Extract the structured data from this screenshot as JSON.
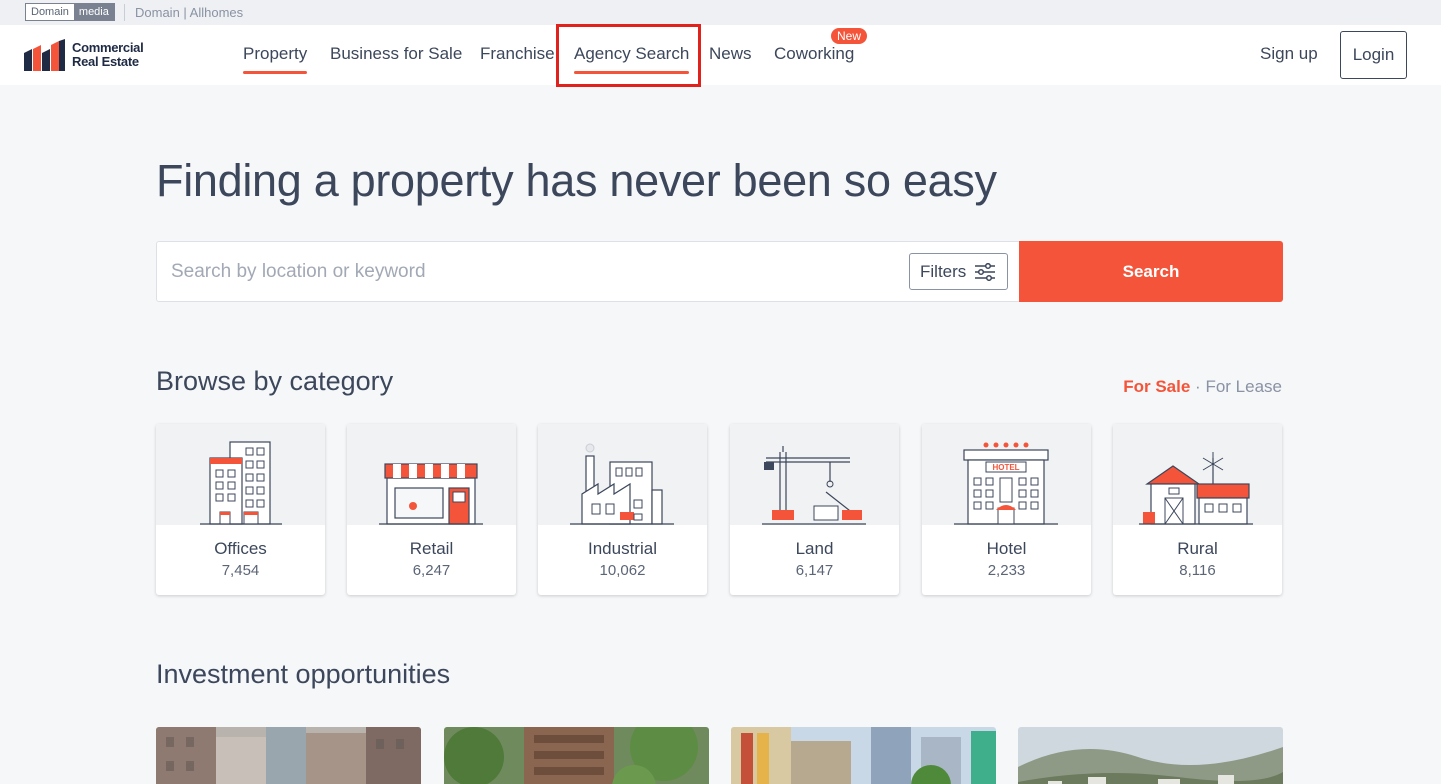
{
  "mediabar": {
    "badge_left": "Domain",
    "badge_right": "media",
    "links": "Domain | Allhomes"
  },
  "header": {
    "logo_line1": "Commercial",
    "logo_line2": "Real Estate",
    "nav": [
      {
        "label": "Property",
        "active": true
      },
      {
        "label": "Business for Sale"
      },
      {
        "label": "Franchise"
      },
      {
        "label": "Agency Search",
        "active": true
      },
      {
        "label": "News"
      },
      {
        "label": "Coworking"
      }
    ],
    "new_badge": "New",
    "signup_label": "Sign up",
    "login_label": "Login"
  },
  "hero": {
    "title": "Finding a property has never been so easy",
    "search_placeholder": "Search by location or keyword",
    "filters_label": "Filters",
    "search_label": "Search"
  },
  "browse": {
    "title": "Browse by category",
    "toggle_on": "For Sale",
    "toggle_sep": "·",
    "toggle_off": "For Lease",
    "categories": [
      {
        "name": "Offices",
        "count": "7,454",
        "icon": "office-building-icon"
      },
      {
        "name": "Retail",
        "count": "6,247",
        "icon": "shopfront-icon"
      },
      {
        "name": "Industrial",
        "count": "10,062",
        "icon": "factory-icon"
      },
      {
        "name": "Land",
        "count": "6,147",
        "icon": "crane-land-icon"
      },
      {
        "name": "Hotel",
        "count": "2,233",
        "icon": "hotel-icon",
        "sign": "HOTEL"
      },
      {
        "name": "Rural",
        "count": "8,116",
        "icon": "barn-windmill-icon"
      }
    ]
  },
  "investment": {
    "title": "Investment opportunities"
  },
  "colors": {
    "accent": "#f4553a",
    "text": "#3c475b",
    "highlight": "#e0211c"
  }
}
